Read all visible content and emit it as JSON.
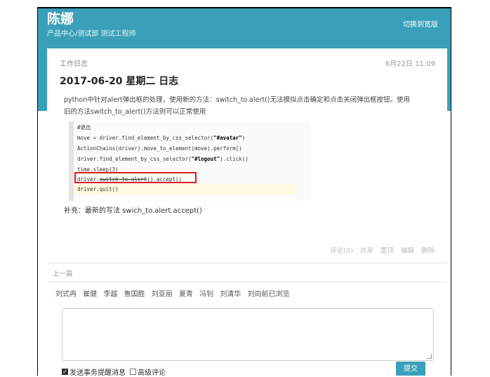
{
  "header": {
    "name": "陈娜",
    "subtitle": "产品中心/测试部  测试工程师",
    "switch_label": "切换到宽版"
  },
  "post": {
    "label": "工作日志",
    "timestamp": "6月22日 11:09",
    "title": "2017-06-20 星期二 日志",
    "description_line1": "python中针对alert弹出框的处理，使用新的方法：switch_to.alert()无法模拟点击确定和点击关闭弹出框按钮。使用",
    "description_line2": "旧的方法switch_to_alert()方法则可以正常使用",
    "code": {
      "l1": "#退出",
      "l2a": "move = driver.find_element_by_css_selector(",
      "l2s": "\"#avatar\"",
      "l2b": ")",
      "l3": "ActionChains(driver).move_to_element(move).perform()",
      "l4a": "driver.find_element_by_css_selector(",
      "l4s": "\"#logout\"",
      "l4b": ").click()",
      "l5": "time.sleep(3)",
      "l6a": "driver.",
      "l6s": "switch_to_alert",
      "l6b": "().accept()",
      "l7": "driver.quit()"
    },
    "supplement": "补充：最新的写法 swich_to.alert.accept()",
    "actions": {
      "comment": "评论(0)",
      "share": "共享",
      "top": "置顶",
      "edit": "编辑",
      "delete": "删除"
    }
  },
  "nav": {
    "prev": "上一篇"
  },
  "readers": [
    "刘式冉",
    "崔健",
    "李越",
    "鲁国胜",
    "刘亚丽",
    "夏青",
    "冯钊",
    "刘清华",
    "刘向前已浏览"
  ],
  "comment_form": {
    "placeholder": "",
    "option1": "发送事务提醒消息",
    "option2": "高级评论",
    "submit": "提交"
  },
  "colors": {
    "banner": "#3a9fb8",
    "highlight_box": "#d62020"
  }
}
